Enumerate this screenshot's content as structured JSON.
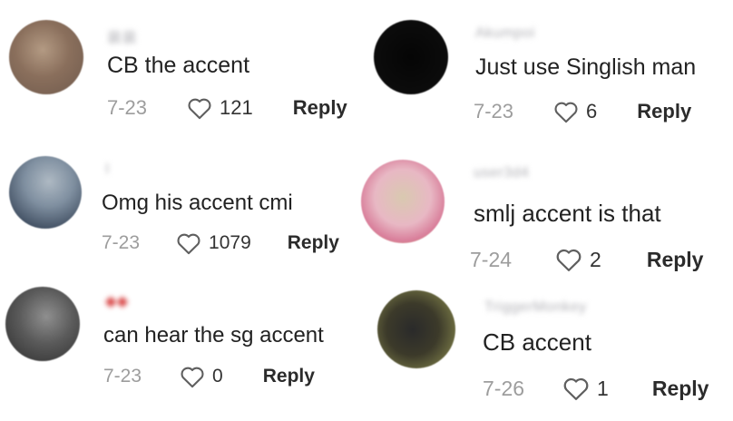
{
  "comments": [
    {
      "username": "裴裴",
      "text": "CB the accent",
      "date": "7-23",
      "likes": "121",
      "reply_label": "Reply"
    },
    {
      "username": "Akumpoi",
      "text": "Just use Singlish man",
      "date": "7-23",
      "likes": "6",
      "reply_label": "Reply"
    },
    {
      "username": "I",
      "text": "Omg his accent cmi",
      "date": "7-23",
      "likes": "1079",
      "reply_label": "Reply"
    },
    {
      "username": "user3d4",
      "text": "smlj accent is that",
      "date": "7-24",
      "likes": "2",
      "reply_label": "Reply"
    },
    {
      "username": "◆◆",
      "text": "can hear the sg accent",
      "date": "7-23",
      "likes": "0",
      "reply_label": "Reply"
    },
    {
      "username": "TriggerMonkey",
      "text": "CB accent",
      "date": "7-26",
      "likes": "1",
      "reply_label": "Reply"
    }
  ],
  "icons": {
    "like": "heart-outline-icon"
  },
  "colors": {
    "date": "#9d9d9d",
    "text": "#222222",
    "reply": "#2b2b2b"
  }
}
